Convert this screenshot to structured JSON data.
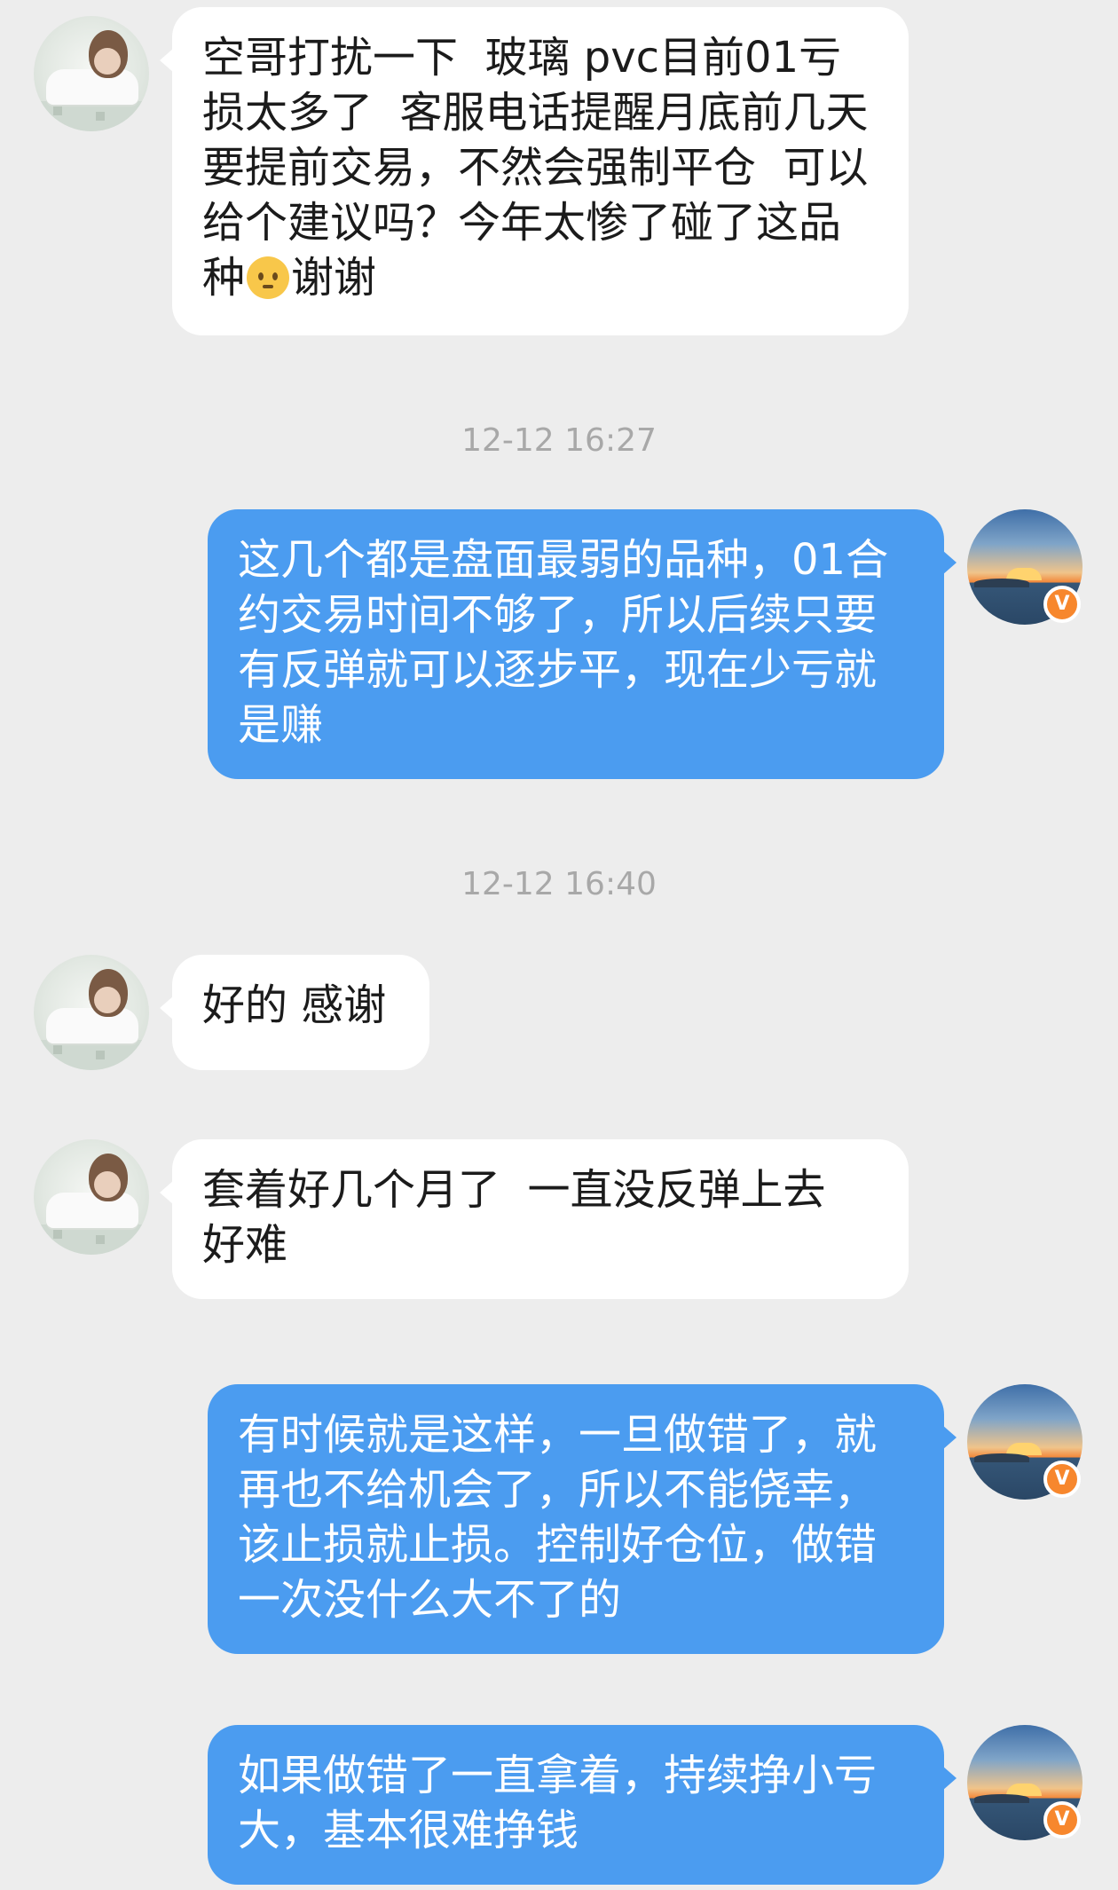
{
  "chat": {
    "messages": [
      {
        "id": "m1",
        "side": "left",
        "text_before_emoji": "空哥打扰一下  玻璃 pvc目前01亏损太多了  客服电话提醒月底前几天要提前交易，不然会强制平仓  可以给个建议吗？今年太惨了碰了这品种",
        "emoji": "sad-face",
        "text_after_emoji": "谢谢"
      },
      {
        "id": "ts1",
        "type": "timestamp",
        "text": "12-12 16:27"
      },
      {
        "id": "m2",
        "side": "right",
        "text": "这几个都是盘面最弱的品种，01合约交易时间不够了，所以后续只要有反弹就可以逐步平，现在少亏就是赚"
      },
      {
        "id": "ts2",
        "type": "timestamp",
        "text": "12-12 16:40"
      },
      {
        "id": "m3",
        "side": "left",
        "text": "好的 感谢"
      },
      {
        "id": "m4",
        "side": "left",
        "text": "套着好几个月了  一直没反弹上去 好难"
      },
      {
        "id": "m5",
        "side": "right",
        "text": "有时候就是这样，一旦做错了，就再也不给机会了，所以不能侥幸，该止损就止损。控制好仓位，做错一次没什么大不了的"
      },
      {
        "id": "m6",
        "side": "right",
        "text": "如果做错了一直拿着，持续挣小亏大，基本很难挣钱"
      }
    ]
  },
  "avatars": {
    "user": "user-avatar-photo",
    "host": "sunset-avatar-photo",
    "host_badge": "V"
  },
  "colors": {
    "background": "#ededed",
    "host_bubble": "#4b9cf0",
    "user_bubble": "#ffffff",
    "badge": "#f7872d",
    "timestamp": "#a8a8a8"
  }
}
